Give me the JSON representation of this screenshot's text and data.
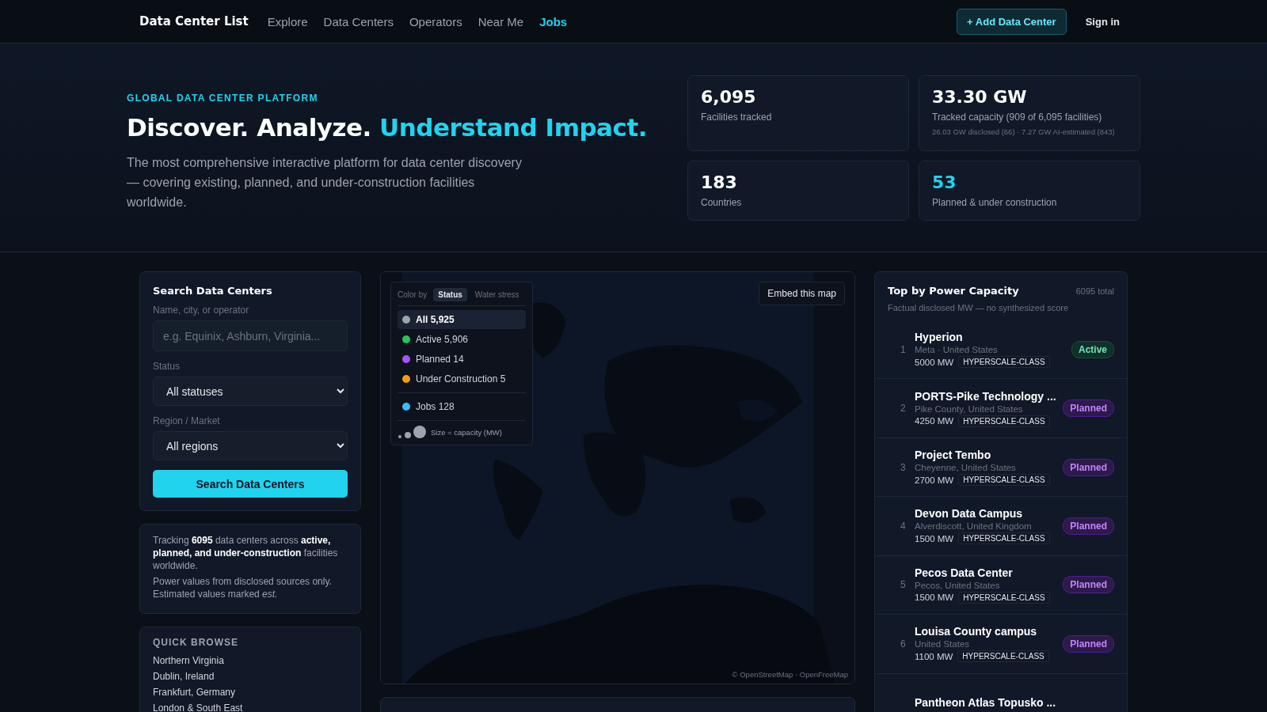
{
  "nav": {
    "brand": "Data Center List",
    "links": [
      {
        "label": "Explore",
        "selected": false
      },
      {
        "label": "Data Centers",
        "selected": false
      },
      {
        "label": "Operators",
        "selected": false
      },
      {
        "label": "Near Me",
        "selected": false
      },
      {
        "label": "Jobs",
        "selected": true
      }
    ],
    "add_button": "+ Add Data Center",
    "sign_in": "Sign in"
  },
  "hero": {
    "eyebrow": "GLOBAL DATA CENTER PLATFORM",
    "title": "Discover. Analyze.",
    "title_accent": "Understand Impact.",
    "lead": "The most comprehensive interactive platform for data center discovery — covering existing, planned, and under-construction facilities worldwide.",
    "stats": [
      {
        "value": "6,095",
        "label": "Facilities tracked",
        "accent": false
      },
      {
        "value": "33.30 GW",
        "label": "Tracked capacity (909 of 6,095 facilities)",
        "note": "26.03 GW disclosed (66) · 7.27 GW AI-estimated (843)",
        "accent": false
      },
      {
        "value": "183",
        "label": "Countries",
        "accent": false
      },
      {
        "value": "53",
        "label": "Planned & under construction",
        "accent": true
      }
    ]
  },
  "search": {
    "title": "Search Data Centers",
    "name_label": "Name, city, or operator",
    "name_placeholder": "e.g. Equinix, Ashburn, Virginia...",
    "status_label": "Status",
    "status_value": "All statuses",
    "region_label": "Region / Market",
    "region_value": "All regions",
    "button": "Search Data Centers"
  },
  "info": [
    "Tracking **6095** data centers across **active, planned, and under-construction** facilities worldwide.",
    "Power values from disclosed sources only. Estimated values marked *est.*"
  ],
  "quick_browse": {
    "title": "QUICK BROWSE",
    "items": [
      "Northern Virginia",
      "Dublin, Ireland",
      "Frankfurt, Germany",
      "London & South East"
    ]
  },
  "map": {
    "color_by": "Color by",
    "modes": [
      {
        "label": "Status",
        "selected": true
      },
      {
        "label": "Water stress",
        "selected": false
      }
    ],
    "items": [
      {
        "label": "All 5,925",
        "color": "#9ca3af",
        "selected": true
      },
      {
        "label": "Active 5,906",
        "color": "#22c55e",
        "selected": false
      },
      {
        "label": "Planned 14",
        "color": "#a855f7",
        "selected": false
      },
      {
        "label": "Under Construction 5",
        "color": "#f59e0b",
        "selected": false
      }
    ],
    "layers": [
      {
        "label": "Jobs 128",
        "color": "#38bdf8",
        "selected": false
      }
    ],
    "size_note": "Size = capacity (MW)",
    "embed": "Embed this map",
    "attribution": "© OpenStreetMap · OpenFreeMap"
  },
  "top": {
    "title": "Top by Power Capacity",
    "total": "6095 total",
    "subtitle": "Factual disclosed MW — no synthesized score",
    "rows": [
      {
        "rank": "1",
        "name": "Hyperion",
        "place": "Meta · United States",
        "power": "5000 MW",
        "tag": "HYPERSCALE-CLASS",
        "status": "Active",
        "kind": "active"
      },
      {
        "rank": "2",
        "name": "PORTS-Pike Technology ...",
        "place": "Pike County, United States",
        "power": "4250 MW",
        "tag": "HYPERSCALE-CLASS",
        "status": "Planned",
        "kind": "planned"
      },
      {
        "rank": "3",
        "name": "Project Tembo",
        "place": "Cheyenne, United States",
        "power": "2700 MW",
        "tag": "HYPERSCALE-CLASS",
        "status": "Planned",
        "kind": "planned"
      },
      {
        "rank": "4",
        "name": "Devon Data Campus",
        "place": "Alverdiscott, United Kingdom",
        "power": "1500 MW",
        "tag": "HYPERSCALE-CLASS",
        "status": "Planned",
        "kind": "planned"
      },
      {
        "rank": "5",
        "name": "Pecos Data Center",
        "place": "Pecos, United States",
        "power": "1500 MW",
        "tag": "HYPERSCALE-CLASS",
        "status": "Planned",
        "kind": "planned"
      },
      {
        "rank": "6",
        "name": "Louisa County campus",
        "place": "United States",
        "power": "1100 MW",
        "tag": "HYPERSCALE-CLASS",
        "status": "Planned",
        "kind": "planned"
      },
      {
        "name": "Pantheon Atlas Topusko ..."
      }
    ]
  }
}
